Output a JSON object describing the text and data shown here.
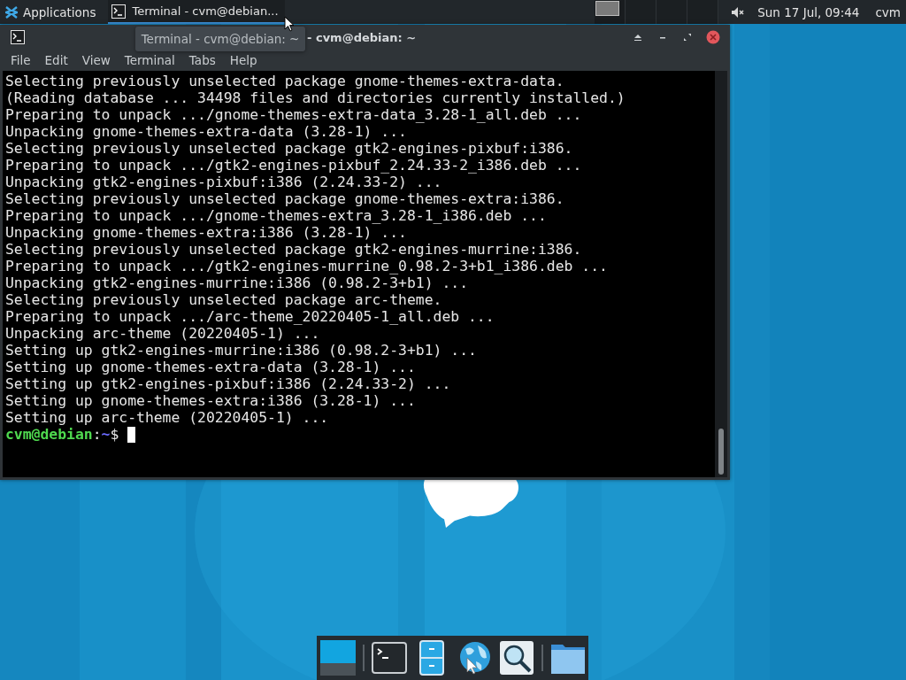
{
  "panel": {
    "applications_label": "Applications",
    "tasks": [
      {
        "title": "Terminal - cvm@debian...",
        "selected": true
      }
    ],
    "workspaces": [
      {
        "selected": true
      },
      {
        "selected": false
      },
      {
        "selected": false
      },
      {
        "selected": false
      }
    ],
    "volume_muted": true,
    "clock": "Sun 17 Jul, 09:44",
    "user": "cvm"
  },
  "window": {
    "title": "- cvm@debian: ~",
    "menu": [
      "File",
      "Edit",
      "View",
      "Terminal",
      "Tabs",
      "Help"
    ],
    "lines": [
      "Selecting previously unselected package gnome-themes-extra-data.",
      "(Reading database ... 34498 files and directories currently installed.)",
      "Preparing to unpack .../gnome-themes-extra-data_3.28-1_all.deb ...",
      "Unpacking gnome-themes-extra-data (3.28-1) ...",
      "Selecting previously unselected package gtk2-engines-pixbuf:i386.",
      "Preparing to unpack .../gtk2-engines-pixbuf_2.24.33-2_i386.deb ...",
      "Unpacking gtk2-engines-pixbuf:i386 (2.24.33-2) ...",
      "Selecting previously unselected package gnome-themes-extra:i386.",
      "Preparing to unpack .../gnome-themes-extra_3.28-1_i386.deb ...",
      "Unpacking gnome-themes-extra:i386 (3.28-1) ...",
      "Selecting previously unselected package gtk2-engines-murrine:i386.",
      "Preparing to unpack .../gtk2-engines-murrine_0.98.2-3+b1_i386.deb ...",
      "Unpacking gtk2-engines-murrine:i386 (0.98.2-3+b1) ...",
      "Selecting previously unselected package arc-theme.",
      "Preparing to unpack .../arc-theme_20220405-1_all.deb ...",
      "Unpacking arc-theme (20220405-1) ...",
      "Setting up gtk2-engines-murrine:i386 (0.98.2-3+b1) ...",
      "Setting up gnome-themes-extra-data (3.28-1) ...",
      "Setting up gtk2-engines-pixbuf:i386 (2.24.33-2) ...",
      "Setting up gnome-themes-extra:i386 (3.28-1) ...",
      "Setting up arc-theme (20220405-1) ..."
    ],
    "prompt": {
      "user_host": "cvm@debian",
      "separator": ":",
      "path": "~",
      "symbol": "$"
    }
  },
  "tooltip": "Terminal - cvm@debian: ~",
  "dock": [
    {
      "kind": "desktop"
    },
    {
      "kind": "terminal"
    },
    {
      "kind": "files"
    },
    {
      "kind": "browser"
    },
    {
      "kind": "search"
    },
    {
      "kind": "folder"
    }
  ]
}
